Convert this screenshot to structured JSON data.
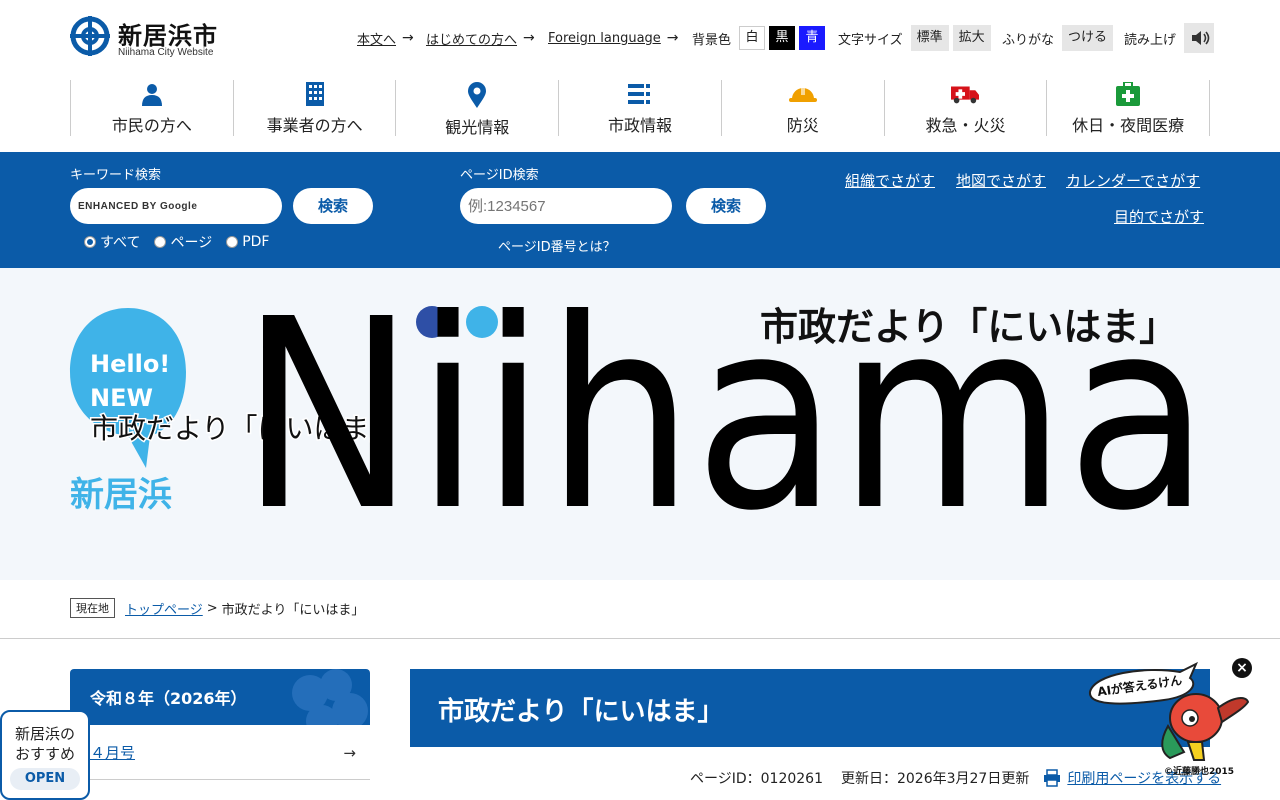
{
  "header": {
    "site_name": "新居浜市",
    "site_sub": "Niihama City Website",
    "links": [
      {
        "label": "本文へ"
      },
      {
        "label": "はじめての方へ"
      },
      {
        "label": "Foreign language"
      }
    ],
    "bg_label": "背景色",
    "bg_white": "白",
    "bg_black": "黒",
    "bg_blue": "青",
    "fontsize_label": "文字サイズ",
    "fontsize_normal": "標準",
    "fontsize_large": "拡大",
    "furigana_label": "ふりがな",
    "furigana_btn": "つける",
    "read_label": "読み上げ"
  },
  "nav": [
    {
      "label": "市民の方へ",
      "icon": "person-icon"
    },
    {
      "label": "事業者の方へ",
      "icon": "building-icon"
    },
    {
      "label": "観光情報",
      "icon": "map-pin-icon"
    },
    {
      "label": "市政情報",
      "icon": "list-icon"
    },
    {
      "label": "防災",
      "icon": "helmet-icon"
    },
    {
      "label": "救急・火災",
      "icon": "ambulance-icon"
    },
    {
      "label": "休日・夜間医療",
      "icon": "first-aid-icon"
    }
  ],
  "search": {
    "keyword_label": "キーワード検索",
    "keyword_placeholder": "ENHANCED BY Google",
    "keyword_btn": "検索",
    "radios": [
      "すべて",
      "ページ",
      "PDF"
    ],
    "pageid_label": "ページID検索",
    "pageid_placeholder": "例:1234567",
    "pageid_btn": "検索",
    "pageid_help": "ページID番号とは？",
    "find_links": [
      "組織でさがす",
      "地図でさがす",
      "カレンダーでさがす",
      "目的でさがす"
    ]
  },
  "hero": {
    "badge_hello": "Hello!",
    "badge_new": "NEW",
    "badge_city": "新居浜",
    "overlay_title": "市政だより「にいはま」",
    "big_word": "Niihama",
    "top_title": "市政だより「にいはま」"
  },
  "breadcrumb": {
    "badge": "現在地",
    "top": "トップページ",
    "sep": ">",
    "current": "市政だより「にいはま」"
  },
  "side": {
    "heading": "令和８年（2026年）",
    "items": [
      {
        "label": "４月号"
      }
    ]
  },
  "main": {
    "title": "市政だより「にいはま」",
    "page_id": "ページID：0120261",
    "updated": "更新日：2026年3月27日更新",
    "print": "印刷用ページを表示する"
  },
  "floating": {
    "osusume_line1": "新居浜の",
    "osusume_line2": "おすすめ",
    "osusume_btn": "OPEN",
    "ai_label": "AIが答えるけん",
    "copyright": "©近藤勝也2015"
  },
  "colors": {
    "brand_blue": "#0b5ba8",
    "light_blue": "#3fb3e8"
  }
}
